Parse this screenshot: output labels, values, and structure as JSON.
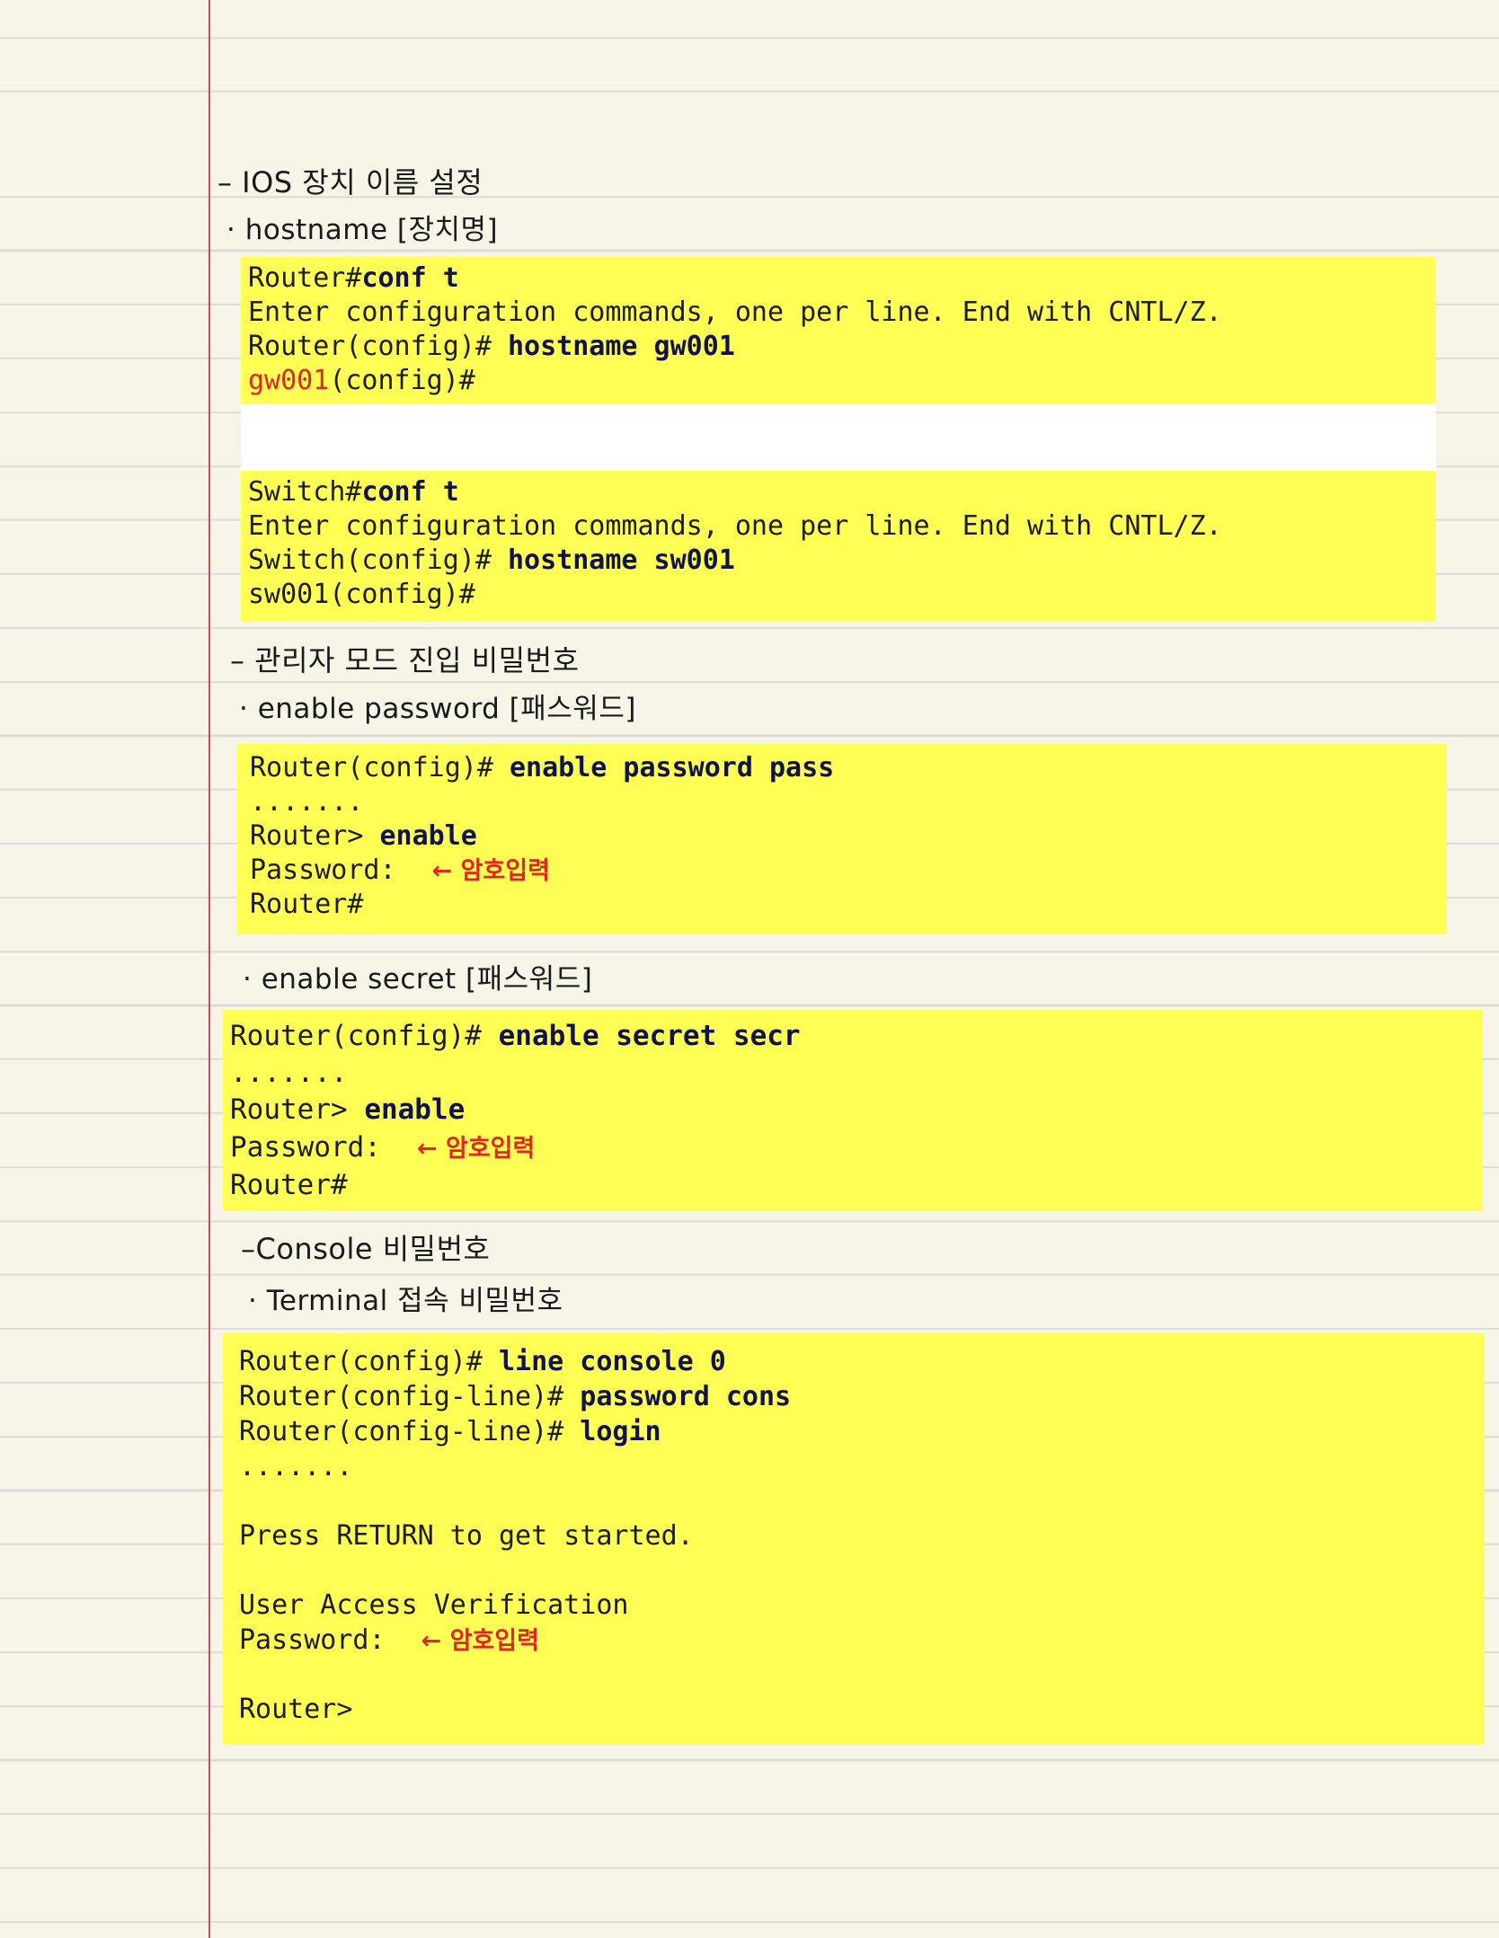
{
  "notes": {
    "h_hostname": "– IOS 장치 이름 설정",
    "s_hostname": "· hostname [장치명]",
    "h_enable": "– 관리자 모드 진입 비밀번호",
    "s_enable_password": "· enable password [패스워드]",
    "s_enable_secret": "· enable secret [패스워드]",
    "h_console": "–Console 비밀번호",
    "s_terminal": "· Terminal 접속 비밀번호"
  },
  "block1": {
    "l1_prompt": "Router#",
    "l1_cmd": "conf t",
    "l2": "Enter configuration commands, one per line. End with CNTL/Z.",
    "l3_prompt": "Router(config)# ",
    "l3_cmd": "hostname gw001",
    "l4_name": "gw001",
    "l4_rest": "(config)#"
  },
  "block2": {
    "l1_prompt": "Switch#",
    "l1_cmd": "conf t",
    "l2": "Enter configuration commands, one per line. End with CNTL/Z.",
    "l3_prompt": "Switch(config)# ",
    "l3_cmd": "hostname sw001",
    "l4": "sw001(config)#"
  },
  "block3": {
    "l1_prompt": "Router(config)# ",
    "l1_cmd": "enable password pass",
    "l2": ".......",
    "l3_prompt": "Router> ",
    "l3_cmd": "enable",
    "l4": "Password:",
    "l4_anno": "← 암호입력",
    "l5": "Router#"
  },
  "block4": {
    "l1_prompt": "Router(config)# ",
    "l1_cmd": "enable secret secr",
    "l2": ".......",
    "l3_prompt": "Router> ",
    "l3_cmd": "enable",
    "l4": "Password:",
    "l4_anno": "← 암호입력",
    "l5": "Router#"
  },
  "block5": {
    "l1_prompt": "Router(config)# ",
    "l1_cmd": "line console 0",
    "l2_prompt": "Router(config-line)# ",
    "l2_cmd": "password cons",
    "l3_prompt": "Router(config-line)# ",
    "l3_cmd": "login",
    "l4": ".......",
    "l5": "Press RETURN to get started.",
    "l6": "User Access Verification",
    "l7": "Password:",
    "l7_anno": "← 암호입력",
    "l8": "Router>"
  }
}
